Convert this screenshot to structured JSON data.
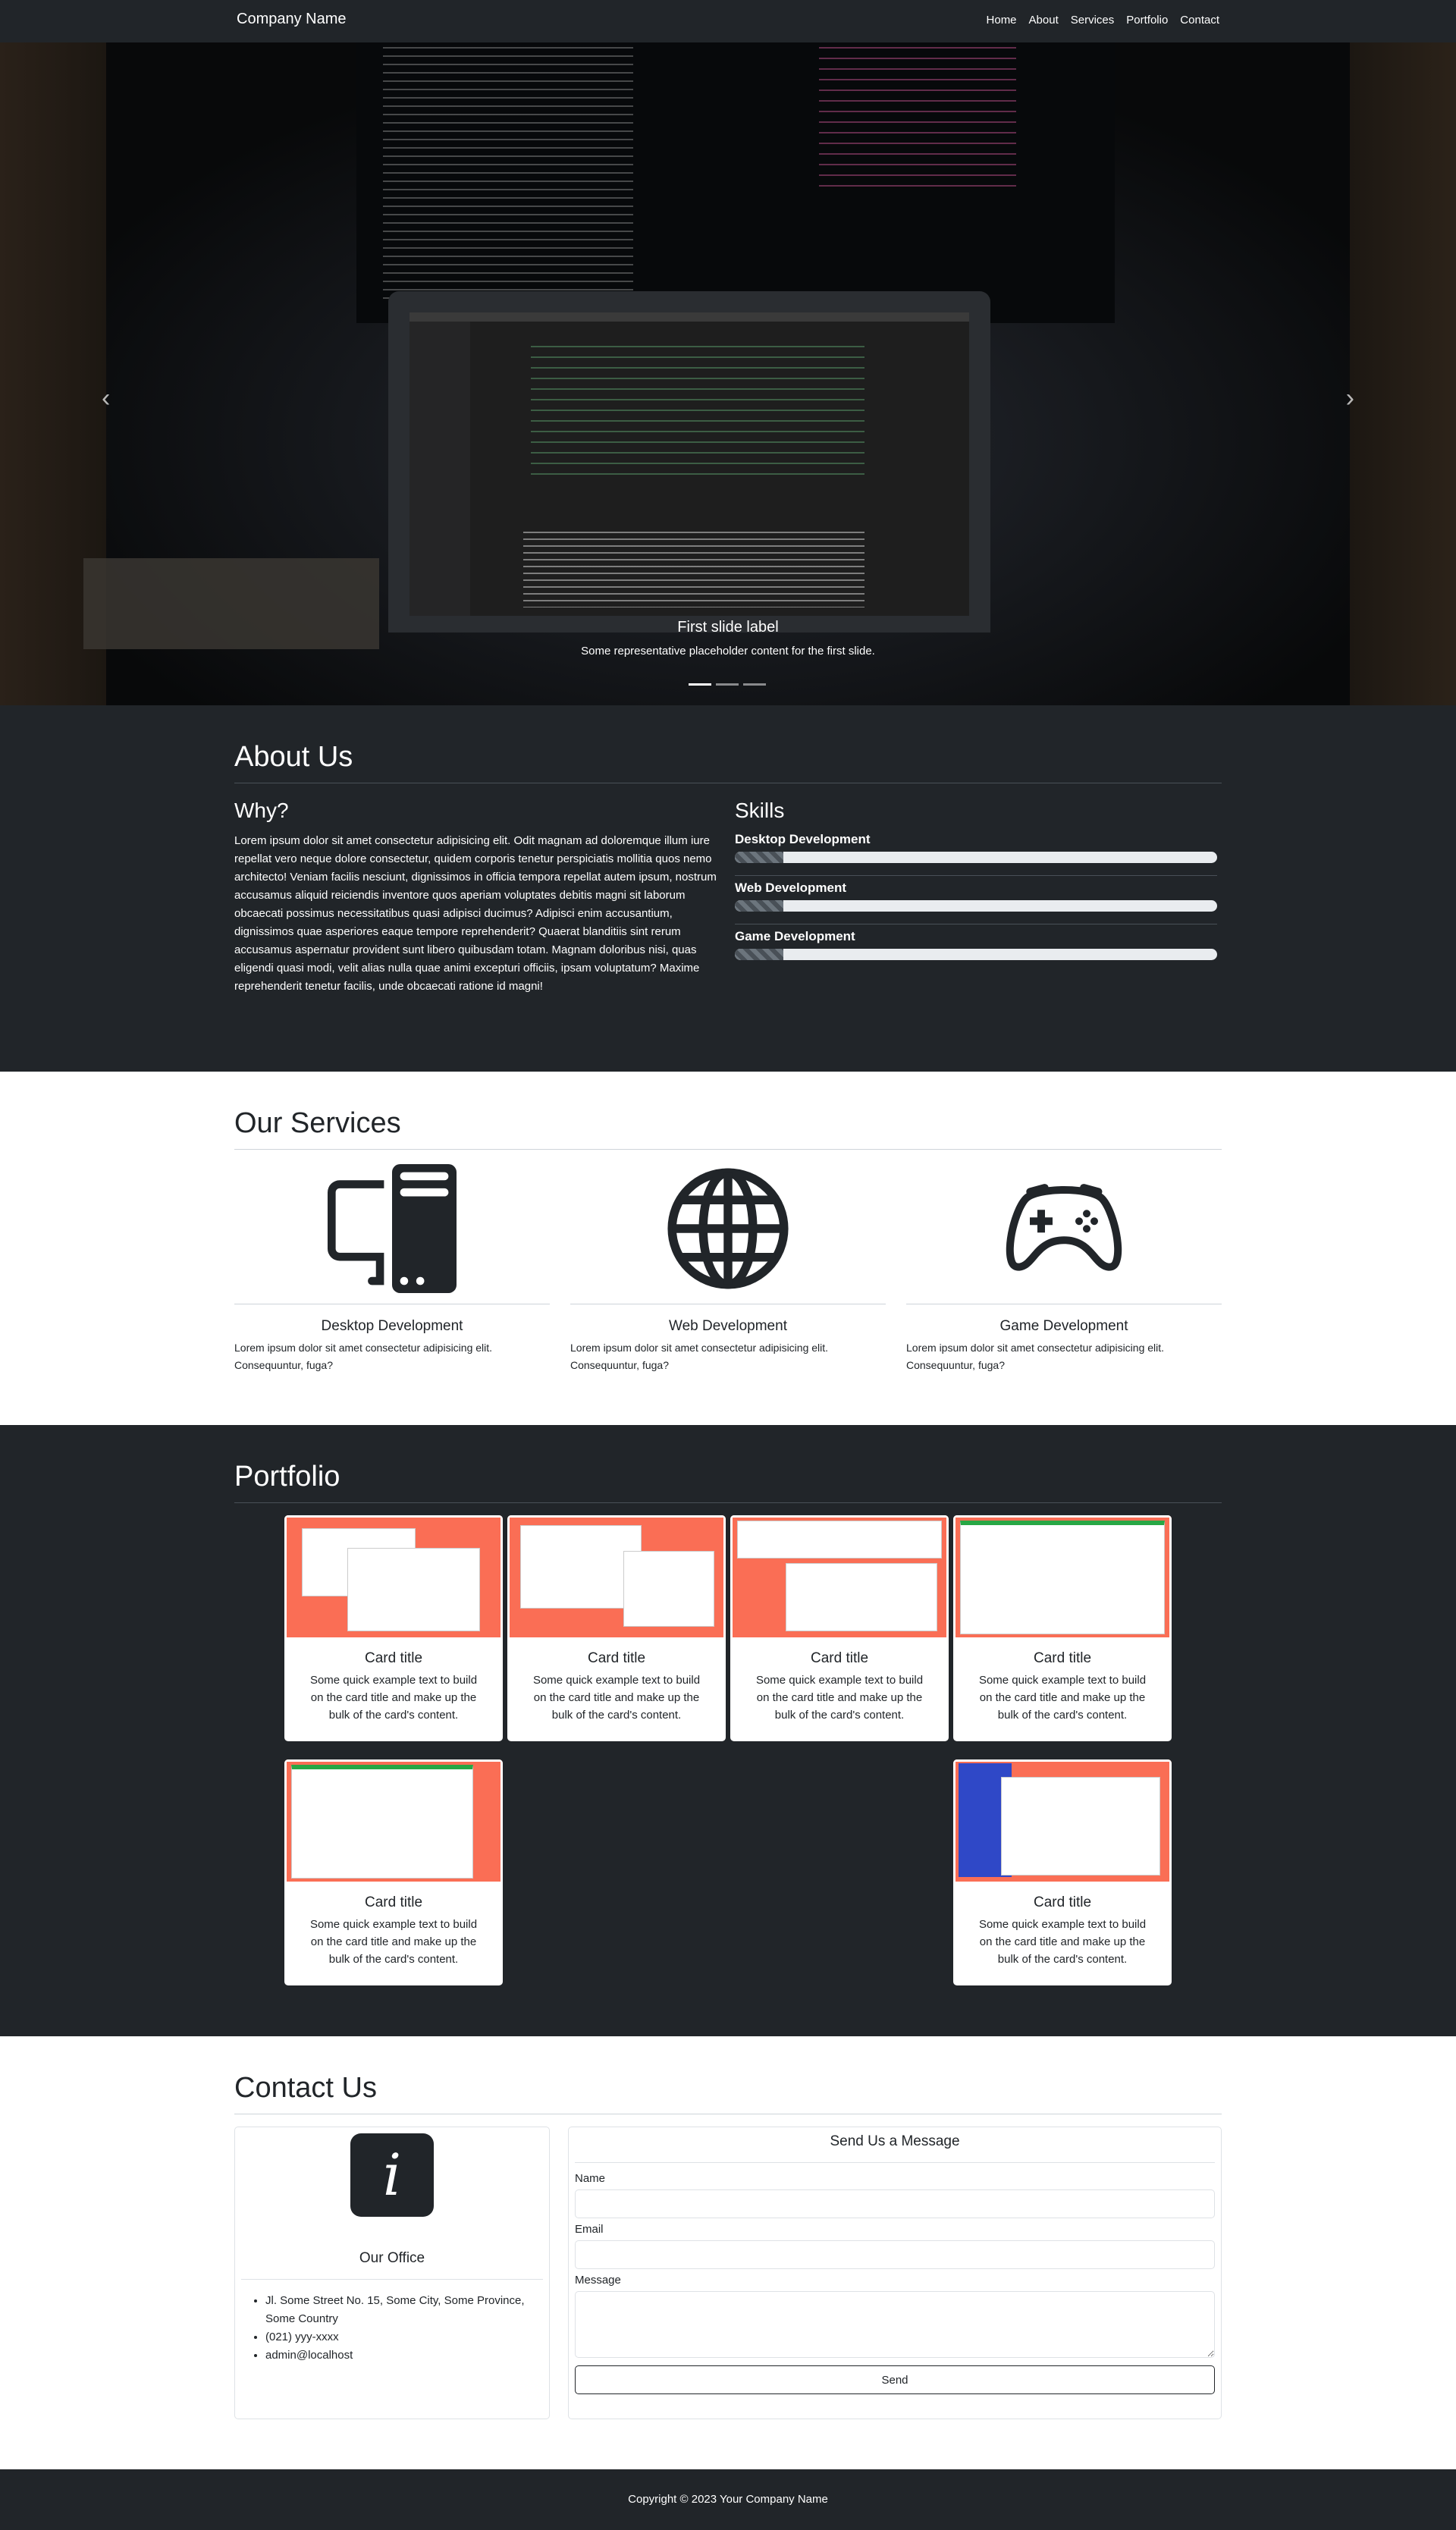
{
  "navbar": {
    "brand": "Company Name",
    "links": [
      "Home",
      "About",
      "Services",
      "Portfolio",
      "Contact"
    ]
  },
  "hero": {
    "caption_title": "First slide label",
    "caption_text": "Some representative placeholder content for the first slide.",
    "prev_icon": "chevron-left-icon",
    "next_icon": "chevron-right-icon",
    "slide_count": 3,
    "active_slide": 1
  },
  "about": {
    "title": "About Us",
    "why_title": "Why?",
    "why_text": "Lorem ipsum dolor sit amet consectetur adipisicing elit. Odit magnam ad doloremque illum iure repellat vero neque dolore consectetur, quidem corporis tenetur perspiciatis mollitia quos nemo architecto! Veniam facilis nesciunt, dignissimos in officia tempora repellat autem ipsum, nostrum accusamus aliquid reiciendis inventore quos aperiam voluptates debitis magni sit laborum obcaecati possimus necessitatibus quasi adipisci ducimus? Adipisci enim accusantium, dignissimos quae asperiores eaque tempore reprehenderit? Quaerat blanditiis sint rerum accusamus aspernatur provident sunt libero quibusdam totam. Magnam doloribus nisi, quas eligendi quasi modi, velit alias nulla quae animi excepturi officiis, ipsam voluptatum? Maxime reprehenderit tenetur facilis, unde obcaecati ratione id magni!",
    "skills_title": "Skills",
    "skills": [
      {
        "name": "Desktop Development",
        "progress": 0.1
      },
      {
        "name": "Web Development",
        "progress": 0.1
      },
      {
        "name": "Game Development",
        "progress": 0.1
      }
    ]
  },
  "services": {
    "title": "Our Services",
    "items": [
      {
        "name": "Desktop Development",
        "text": "Lorem ipsum dolor sit amet consectetur adipisicing elit. Consequuntur, fuga?",
        "icon": "pc-display-icon"
      },
      {
        "name": "Web Development",
        "text": "Lorem ipsum dolor sit amet consectetur adipisicing elit. Consequuntur, fuga?",
        "icon": "globe-icon"
      },
      {
        "name": "Game Development",
        "text": "Lorem ipsum dolor sit amet consectetur adipisicing elit. Consequuntur, fuga?",
        "icon": "controller-icon"
      }
    ]
  },
  "portfolio": {
    "title": "Portfolio",
    "cards": [
      {
        "title": "Card title",
        "text": "Some quick example text to build on the card title and make up the bulk of the card's content."
      },
      {
        "title": "Card title",
        "text": "Some quick example text to build on the card title and make up the bulk of the card's content."
      },
      {
        "title": "Card title",
        "text": "Some quick example text to build on the card title and make up the bulk of the card's content."
      },
      {
        "title": "Card title",
        "text": "Some quick example text to build on the card title and make up the bulk of the card's content."
      },
      {
        "title": "Card title",
        "text": "Some quick example text to build on the card title and make up the bulk of the card's content."
      },
      {
        "title": "Card title",
        "text": "Some quick example text to build on the card title and make up the bulk of the card's content."
      }
    ]
  },
  "contact": {
    "title": "Contact Us",
    "office_title": "Our Office",
    "office_items": [
      "Jl. Some Street No. 15, Some City, Some Province, Some Country",
      "(021) yyy-xxxx",
      "admin@localhost"
    ],
    "form_title": "Send Us a Message",
    "name_label": "Name",
    "name_value": "",
    "email_label": "Email",
    "email_value": "",
    "message_label": "Message",
    "message_value": "",
    "send_label": "Send"
  },
  "footer": {
    "text": "Copyright © 2023 Your Company Name"
  },
  "colors": {
    "dark": "#212529",
    "accent": "#fa6e55",
    "light_border": "#dee2e6"
  }
}
